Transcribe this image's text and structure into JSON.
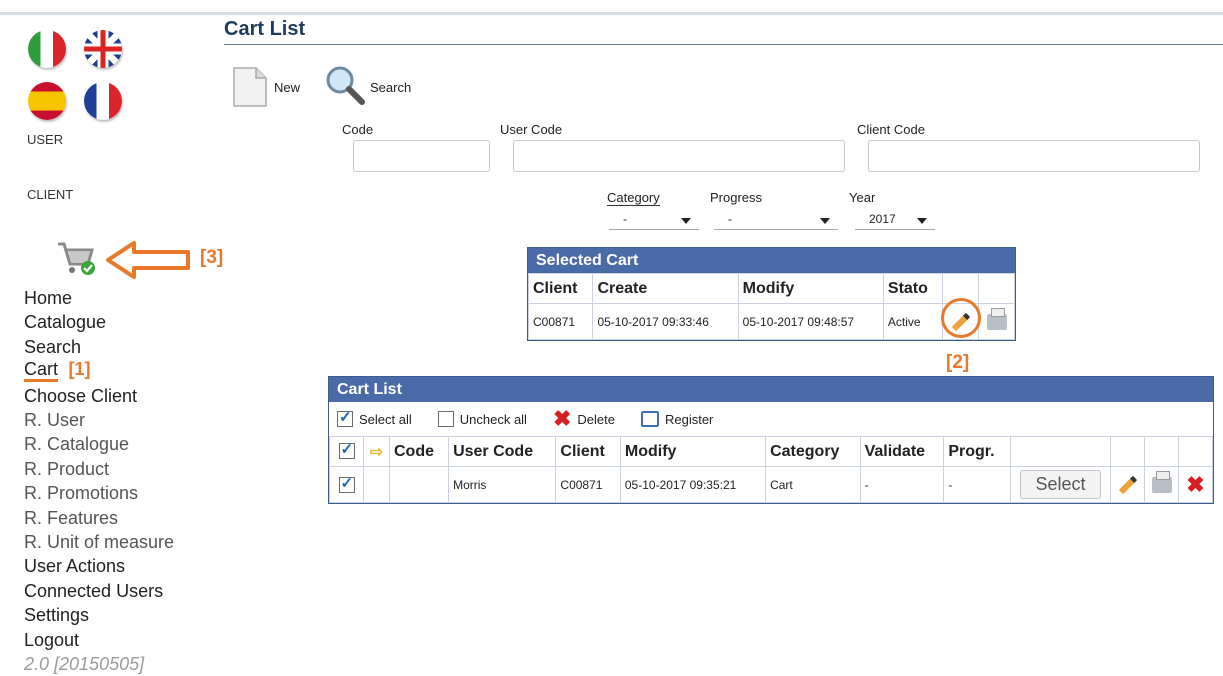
{
  "sidebar": {
    "user_label": "USER",
    "client_label": "CLIENT",
    "cart_icon": "shopping-cart-check-icon",
    "annotation_3": "[3]",
    "nav": [
      {
        "label": "Home"
      },
      {
        "label": "Catalogue"
      },
      {
        "label": "Search"
      },
      {
        "label": "Cart",
        "annotation": "[1]"
      },
      {
        "label": "Choose Client"
      },
      {
        "label": "R. User"
      },
      {
        "label": "R. Catalogue"
      },
      {
        "label": "R. Product"
      },
      {
        "label": "R. Promotions"
      },
      {
        "label": "R. Features"
      },
      {
        "label": "R. Unit of measure"
      },
      {
        "label": "User Actions"
      },
      {
        "label": "Connected Users"
      },
      {
        "label": "Settings"
      },
      {
        "label": "Logout"
      }
    ],
    "version": "2.0 [20150505]"
  },
  "page": {
    "title": "Cart List",
    "toolbar": {
      "new_label": "New",
      "search_label": "Search"
    }
  },
  "filters": {
    "code_label": "Code",
    "user_code_label": "User Code",
    "client_code_label": "Client Code",
    "category_label": "Category",
    "category_value": "-",
    "progress_label": "Progress",
    "progress_value": "-",
    "year_label": "Year",
    "year_value": "2017"
  },
  "selected_cart": {
    "title": "Selected Cart",
    "headers": [
      "Client",
      "Create",
      "Modify",
      "Stato"
    ],
    "row": {
      "client": "C00871",
      "create": "05-10-2017 09:33:46",
      "modify": "05-10-2017 09:48:57",
      "stato": "Active"
    },
    "annotation_2": "[2]"
  },
  "cart_list": {
    "title": "Cart List",
    "actions": {
      "select_all": "Select all",
      "uncheck_all": "Uncheck all",
      "delete": "Delete",
      "register": "Register"
    },
    "headers": [
      "Code",
      "User Code",
      "Client",
      "Modify",
      "Category",
      "Validate",
      "Progr."
    ],
    "row": {
      "code": "",
      "user_code": "Morris",
      "client": "C00871",
      "modify": "05-10-2017 09:35:21",
      "category": "Cart",
      "validate": "-",
      "progr": "-",
      "select_label": "Select"
    }
  },
  "colors": {
    "accent": "#4a6aa8",
    "annotation": "#e8782a"
  }
}
